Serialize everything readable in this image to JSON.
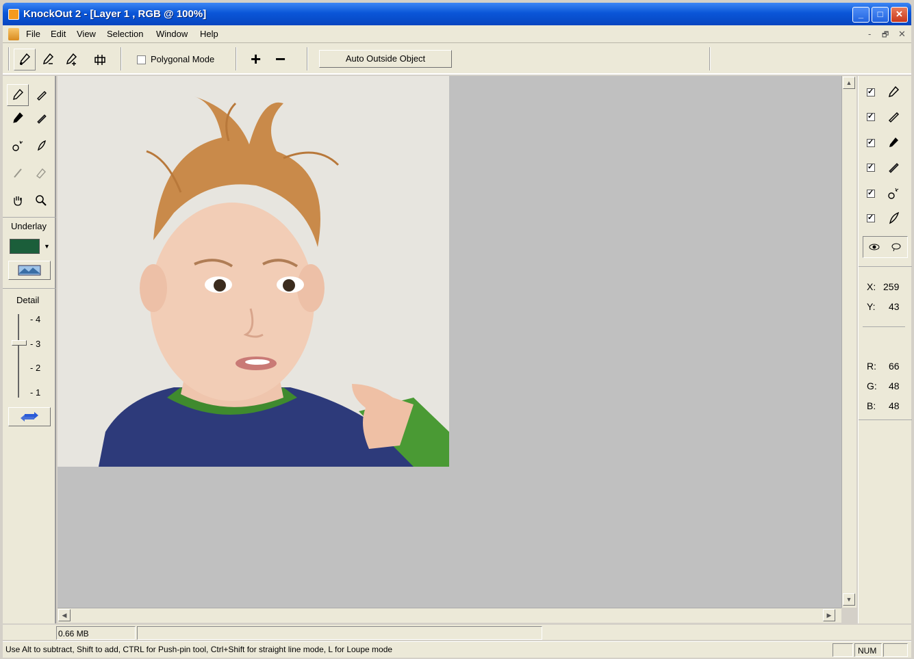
{
  "window": {
    "title": "KnockOut 2 - [Layer 1 , RGB @ 100%]",
    "minimize": "_",
    "maximize": "□",
    "close": "✕"
  },
  "menubar": {
    "items": [
      "File",
      "Edit",
      "View",
      "Selection",
      "Window",
      "Help"
    ],
    "mdi_min": "-",
    "mdi_restore": "🗗",
    "mdi_close": "✕"
  },
  "toolbar": {
    "tools": [
      "inside-object-tool",
      "outside-object-tool",
      "inside-object-tool-2",
      "push-pin-tool"
    ],
    "polygonal_mode_label": "Polygonal Mode",
    "plus_label": "+",
    "minus_label": "−",
    "auto_outside_label": "Auto Outside Object"
  },
  "left_panel": {
    "underlay_label": "Underlay",
    "underlay_color": "#1b5e3a",
    "detail_label": "Detail",
    "detail_ticks": [
      "4",
      "3",
      "2",
      "1"
    ],
    "detail_value": 3
  },
  "right_panel": {
    "x_label": "X:",
    "x_value": "259",
    "y_label": "Y:",
    "y_value": "43",
    "r_label": "R:",
    "r_value": "66",
    "g_label": "G:",
    "g_value": "48",
    "b_label": "B:",
    "b_value": "48"
  },
  "status": {
    "memory": "0.66 MB",
    "hint": "Use Alt to subtract, Shift to add, CTRL for Push-pin tool, Ctrl+Shift for straight line mode, L for Loupe mode",
    "num": "NUM"
  },
  "colors": {
    "canvas_bg": "#c0c0c0",
    "panel_bg": "#ece9d8",
    "titlebar": "#0a56d8"
  }
}
